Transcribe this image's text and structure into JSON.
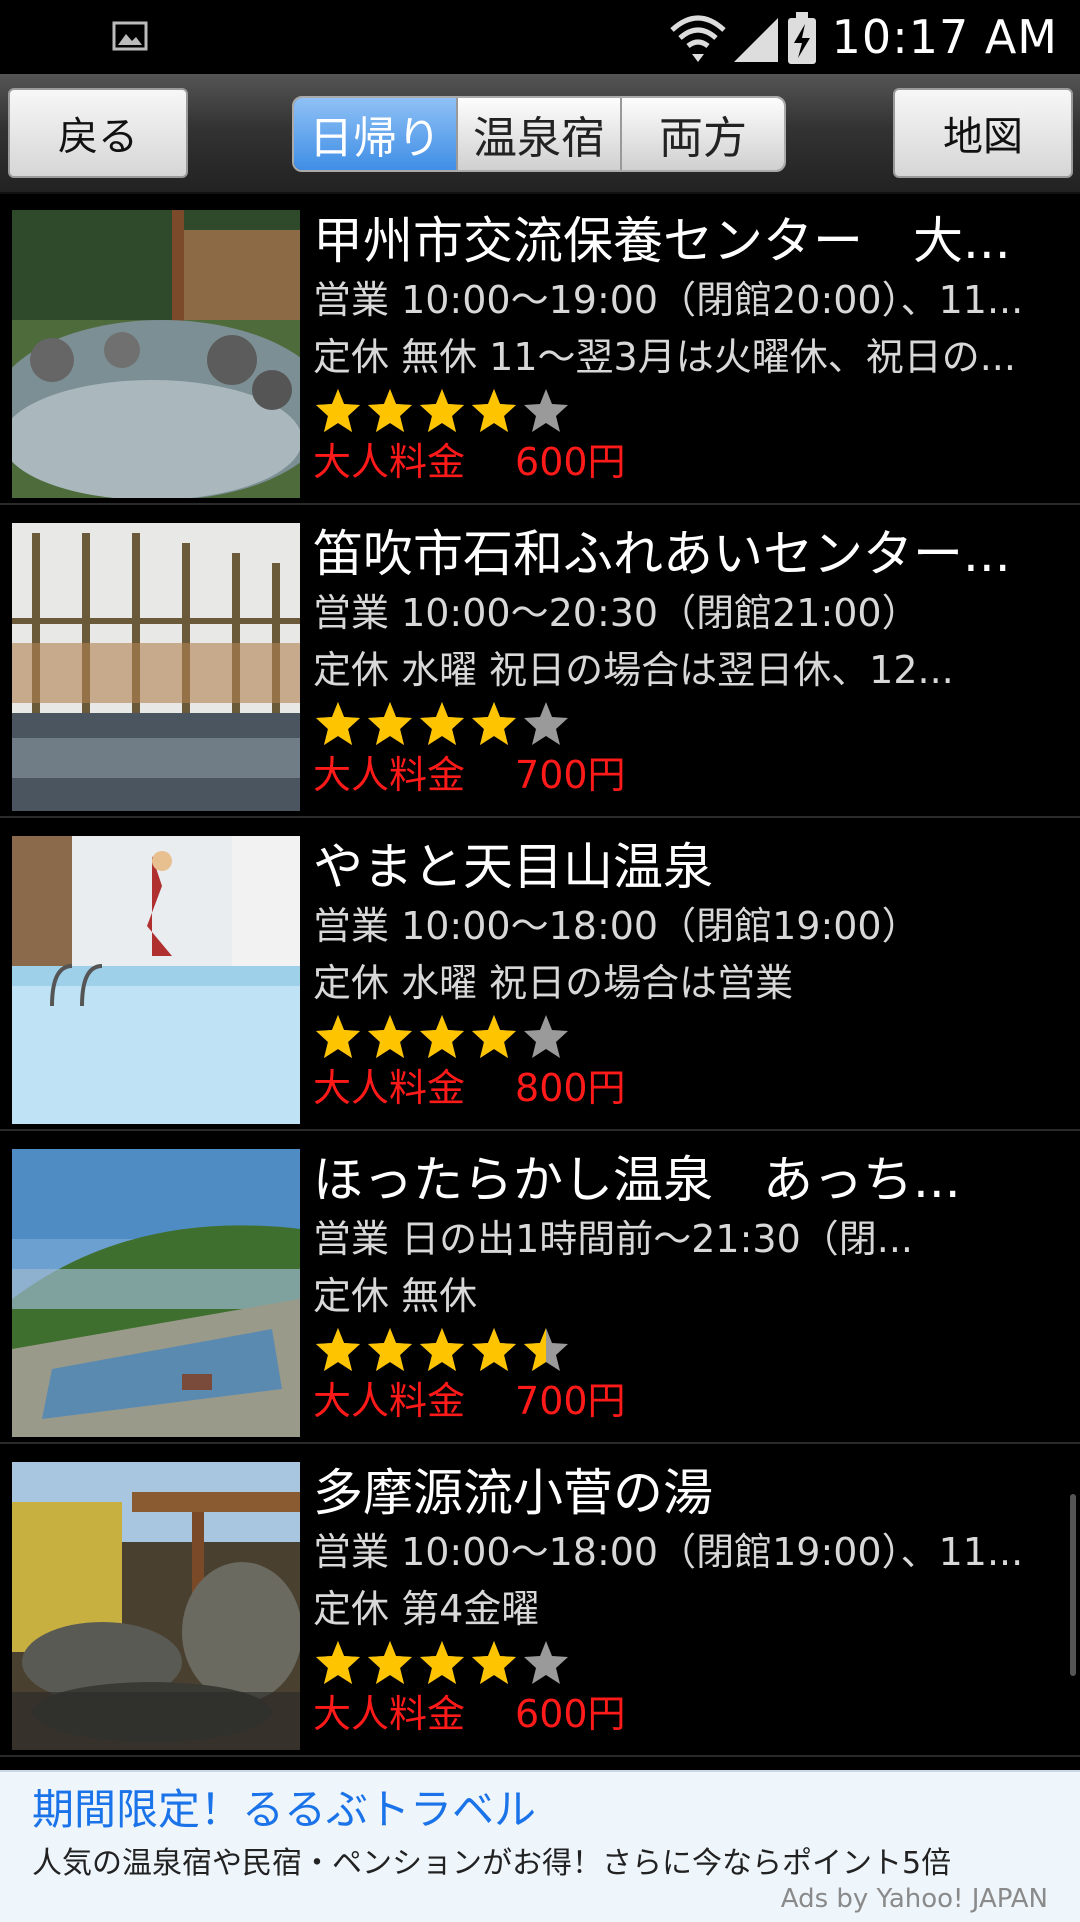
{
  "status_bar": {
    "time": "10:17 AM",
    "icons": [
      "image-icon",
      "wifi-icon",
      "signal-icon",
      "battery-charging-icon"
    ]
  },
  "toolbar": {
    "back_label": "戻る",
    "segments": [
      {
        "label": "日帰り",
        "active": true
      },
      {
        "label": "温泉宿",
        "active": false
      },
      {
        "label": "両方",
        "active": false
      }
    ],
    "map_label": "地図"
  },
  "listings": [
    {
      "title": "甲州市交流保養センター　大...",
      "hours": "営業 10:00〜19:00（閉館20:00）、11...",
      "closed": "定休 無休 11〜翌3月は火曜休、祝日の...",
      "rating": 4,
      "price_label": "大人料金",
      "price": "600円"
    },
    {
      "title": "笛吹市石和ふれあいセンター...",
      "hours": "営業 10:00〜20:30（閉館21:00）",
      "closed": "定休 水曜 祝日の場合は翌日休、12...",
      "rating": 4,
      "price_label": "大人料金",
      "price": "700円"
    },
    {
      "title": "やまと天目山温泉",
      "hours": "営業 10:00〜18:00（閉館19:00）",
      "closed": "定休 水曜 祝日の場合は営業",
      "rating": 4,
      "price_label": "大人料金",
      "price": "800円"
    },
    {
      "title": "ほったらかし温泉　あっち...",
      "hours": "営業 日の出1時間前〜21:30（閉...",
      "closed": "定休 無休",
      "rating": 4.5,
      "price_label": "大人料金",
      "price": "700円"
    },
    {
      "title": "多摩源流小菅の湯",
      "hours": "営業 10:00〜18:00（閉館19:00）、11...",
      "closed": "定休 第4金曜",
      "rating": 4,
      "price_label": "大人料金",
      "price": "600円"
    }
  ],
  "ad": {
    "title": "期間限定！るるぶトラベル",
    "description": "人気の温泉宿や民宿・ペンションがお得！さらに今ならポイント5倍",
    "provider": "Ads by Yahoo! JAPAN"
  },
  "colors": {
    "price": "#ff1a1a",
    "star_filled": "#ffc400",
    "star_empty": "#9a9a9a",
    "segment_active": "#3f8ee6",
    "ad_title": "#1a73e8"
  }
}
